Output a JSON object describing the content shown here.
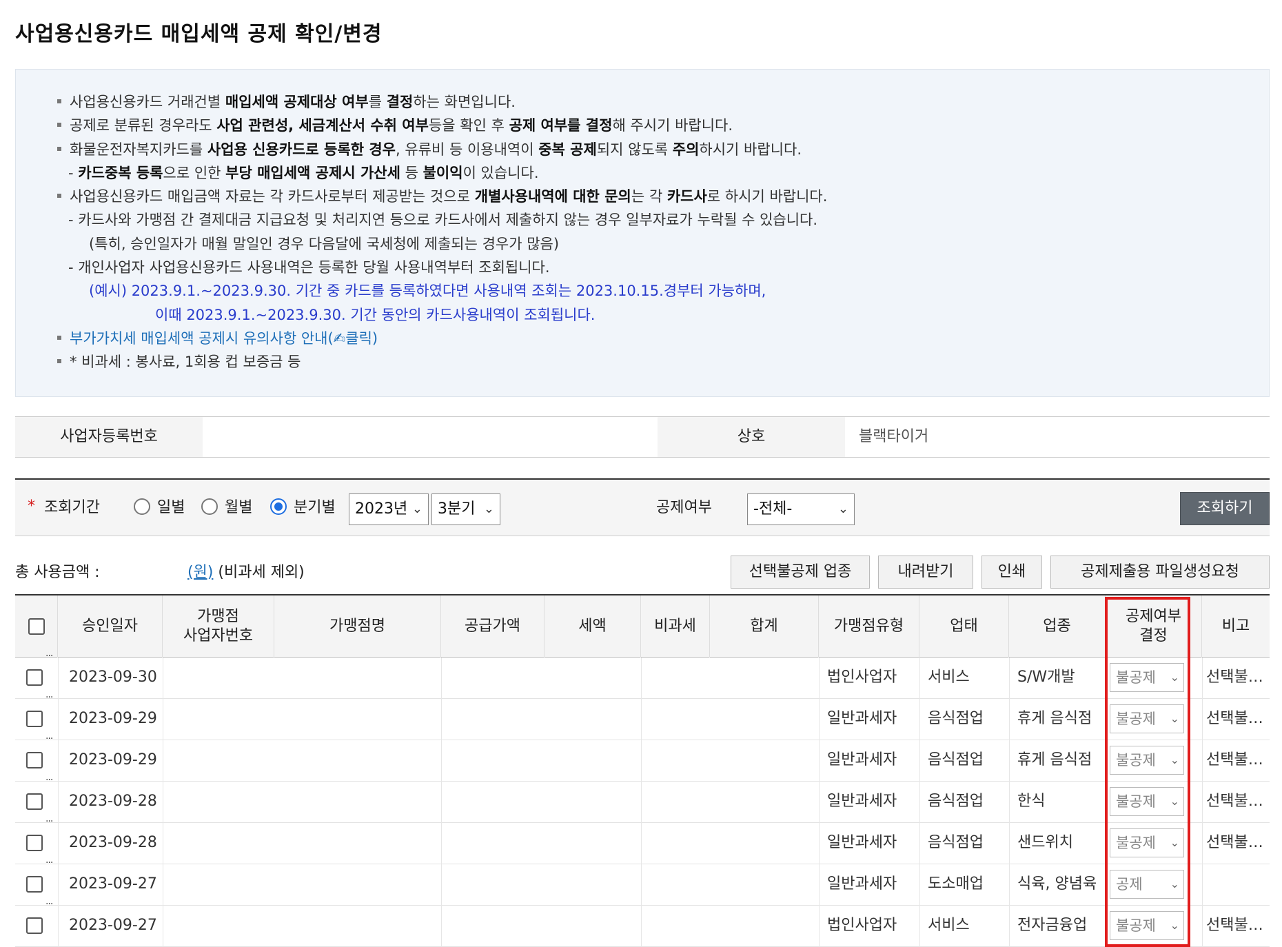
{
  "title": "사업용신용카드 매입세액 공제 확인/변경",
  "notice": {
    "l1": [
      "사업용신용카드 거래건별 ",
      "매입세액 공제대상 여부",
      "를 ",
      "결정",
      "하는 화면입니다."
    ],
    "l2": [
      "공제로 분류된 경우라도 ",
      "사업 관련성, 세금계산서 수취 여부",
      "등을 확인 후 ",
      "공제 여부를 결정",
      "해 주시기 바랍니다."
    ],
    "l3": [
      "화물운전자복지카드를 ",
      "사업용 신용카드로 등록한 경우",
      ", 유류비 등 이용내역이 ",
      "중복 공제",
      "되지 않도록 ",
      "주의",
      "하시기 바랍니다."
    ],
    "l4": [
      "- ",
      "카드중복 등록",
      "으로 인한 ",
      "부당 매입세액 공제시 가산세",
      " 등 ",
      "불이익",
      "이 있습니다."
    ],
    "l5": [
      "사업용신용카드 매입금액 자료는 각 카드사로부터 제공받는 것으로 ",
      "개별사용내역에 대한 문의",
      "는 각 ",
      "카드사",
      "로 하시기 바랍니다."
    ],
    "l6": "- 카드사와 가맹점 간 결제대금 지급요청 및 처리지연 등으로 카드사에서 제출하지 않는 경우 일부자료가 누락될 수 있습니다.",
    "l7": "(특히, 승인일자가 매월 말일인 경우 다음달에 국세청에 제출되는 경우가 많음)",
    "l8": "- 개인사업자 사업용신용카드 사용내역은 등록한 당월 사용내역부터 조회됩니다.",
    "l9": "(예시) 2023.9.1.~2023.9.30. 기간 중 카드를 등록하였다면 사용내역 조회는 2023.10.15.경부터 가능하며,",
    "l10": "이때 2023.9.1.~2023.9.30. 기간 동안의 카드사용내역이 조회됩니다.",
    "l11": "부가가치세 매입세액 공제시 유의사항 안내(✍클릭)",
    "l12": "* 비과세 : 봉사료, 1회용 컵 보증금 등"
  },
  "info": {
    "bizno_label": "사업자등록번호",
    "bizno_value": "",
    "company_label": "상호",
    "company_value": "블랙타이거"
  },
  "search": {
    "period_label": "조회기간",
    "radio_daily": "일별",
    "radio_monthly": "월별",
    "radio_quarterly": "분기별",
    "year": "2023년",
    "quarter": "3분기",
    "deduct_label": "공제여부",
    "deduct_value": "-전체-",
    "query_button": "조회하기"
  },
  "summary": {
    "total_label": "총 사용금액 :",
    "won": "(원)",
    "note": "(비과세 제외)"
  },
  "actions": {
    "btn1": "선택불공제 업종",
    "btn2": "내려받기",
    "btn3": "인쇄",
    "btn4": "공제제출용 파일생성요청"
  },
  "table": {
    "headers": {
      "date": "승인일자",
      "bizno_1": "가맹점",
      "bizno_2": "사업자번호",
      "name": "가맹점명",
      "supply": "공급가액",
      "tax": "세액",
      "nontax": "비과세",
      "sum": "합계",
      "mtype": "가맹점유형",
      "biztype": "업태",
      "industry": "업종",
      "decision_1": "공제여부",
      "decision_2": "결정",
      "remark": "비고"
    },
    "rows": [
      {
        "date": "2023-09-30",
        "mtype": "법인사업자",
        "biztype": "서비스",
        "industry": "S/W개발",
        "decision": "불공제",
        "remark": "선택불공제"
      },
      {
        "date": "2023-09-29",
        "mtype": "일반과세자",
        "biztype": "음식점업",
        "industry": "휴게 음식점",
        "decision": "불공제",
        "remark": "선택불공제"
      },
      {
        "date": "2023-09-29",
        "mtype": "일반과세자",
        "biztype": "음식점업",
        "industry": "휴게 음식점",
        "decision": "불공제",
        "remark": "선택불공제"
      },
      {
        "date": "2023-09-28",
        "mtype": "일반과세자",
        "biztype": "음식점업",
        "industry": "한식",
        "decision": "불공제",
        "remark": "선택불공제"
      },
      {
        "date": "2023-09-28",
        "mtype": "일반과세자",
        "biztype": "음식점업",
        "industry": "샌드위치",
        "decision": "불공제",
        "remark": "선택불공제"
      },
      {
        "date": "2023-09-27",
        "mtype": "일반과세자",
        "biztype": "도소매업",
        "industry": "식육, 양념육",
        "decision": "공제",
        "remark": ""
      },
      {
        "date": "2023-09-27",
        "mtype": "법인사업자",
        "biztype": "서비스",
        "industry": "전자금융업",
        "decision": "불공제",
        "remark": "선택불공제"
      }
    ]
  },
  "colors": {
    "highlight": "#e11d1d",
    "link": "#1e6fb8",
    "example": "#2a3dcc",
    "radio": "#1e6ee0"
  }
}
